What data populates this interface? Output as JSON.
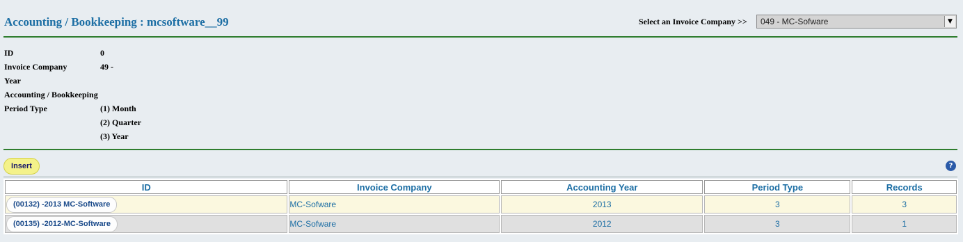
{
  "header": {
    "title": "Accounting / Bookkeeping : mcsoftware__99",
    "select_label": "Select an Invoice Company >>",
    "select_value": "049 - MC-Sofware"
  },
  "details": {
    "id_label": "ID",
    "id_value": "0",
    "company_label": "Invoice Company",
    "company_value": "49 -",
    "year_label": "Year",
    "bookkeeping_label": "Accounting / Bookkeeping",
    "period_label": "Period Type",
    "period_options": [
      "(1) Month",
      "(2) Quarter",
      "(3) Year"
    ]
  },
  "toolbar": {
    "insert_label": "Insert",
    "help_icon": "?"
  },
  "table": {
    "headers": [
      "ID",
      "Invoice Company",
      "Accounting Year",
      "Period Type",
      "Records"
    ],
    "rows": [
      {
        "id": "(00132) -2013 MC-Software",
        "company": "MC-Sofware",
        "year": "2013",
        "period": "3",
        "records": "3"
      },
      {
        "id": "(00135) -2012-MC-Software",
        "company": "MC-Sofware",
        "year": "2012",
        "period": "3",
        "records": "1"
      }
    ]
  }
}
